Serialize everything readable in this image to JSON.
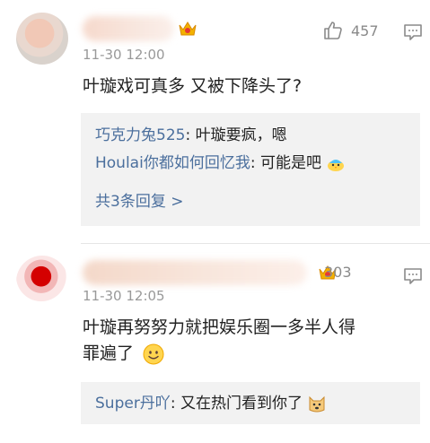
{
  "comments": [
    {
      "likes": "457",
      "time": "11-30 12:00",
      "text": "叶璇戏可真多 又被下降头了?",
      "replies": [
        {
          "user": "巧克力兔525",
          "sep": ":",
          "text": " 叶璇要疯，嗯"
        },
        {
          "user": "Houlai你都如何回忆我",
          "sep": ":",
          "text": " 可能是吧"
        }
      ],
      "more_replies": "共3条回复 >"
    },
    {
      "likes": "303",
      "time": "11-30 12:05",
      "text_line1": "叶璇再努努力就把娱乐圈一多半人得",
      "text_line2": "罪遍了",
      "replies": [
        {
          "user": "Super丹吖",
          "sep": ":",
          "text": " 又在热门看到你了"
        }
      ]
    }
  ],
  "icons": {
    "like": "thumbs-up-icon",
    "reply": "comment-icon",
    "badge": "crown-badge-icon",
    "smile": "smile-emoji",
    "doge": "doge-emoji",
    "chick": "chick-emoji"
  },
  "colors": {
    "link": "#4b6f9d",
    "meta": "#999999",
    "reply_bg": "#f2f2f2"
  }
}
